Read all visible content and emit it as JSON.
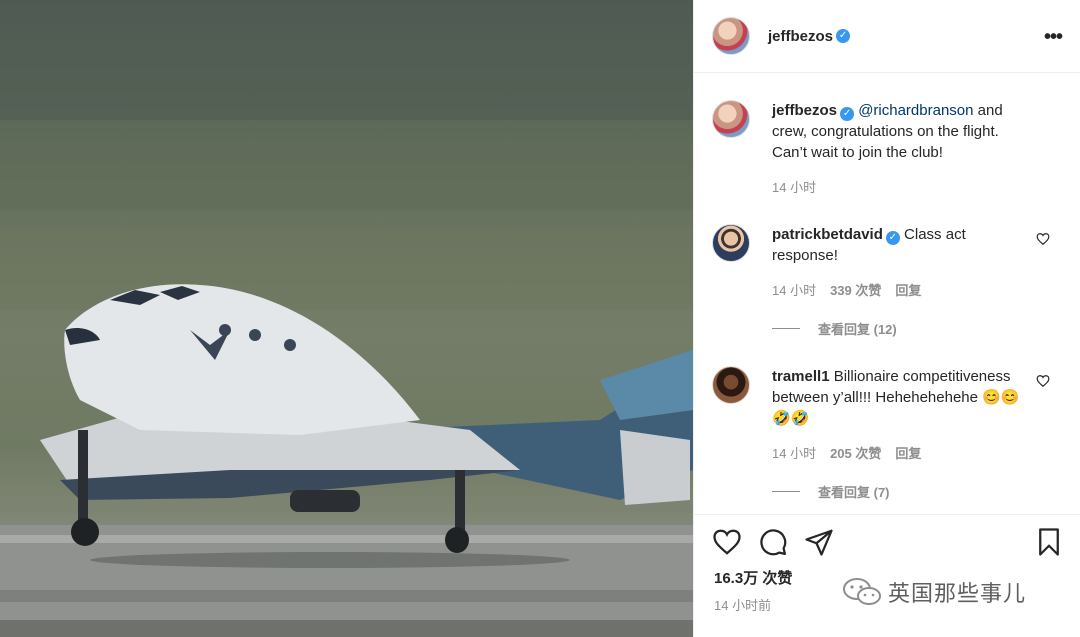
{
  "header": {
    "username": "jeffbezos",
    "more_label": "•••"
  },
  "caption": {
    "username": "jeffbezos",
    "mention": "@richardbranson",
    "text": " and crew, congratulations on the flight. Can’t wait to join the club!",
    "time": "14 小时"
  },
  "comments": [
    {
      "username": "patrickbetdavid",
      "verified": true,
      "text": "Class act response!",
      "time": "14 小时",
      "likes": "339 次赞",
      "reply": "回复",
      "view_replies": "查看回复 (12)"
    },
    {
      "username": "tramell1",
      "verified": false,
      "text": "Billionaire competitiveness between y’all!!! Hehehehehehe 😊😊🤣🤣",
      "time": "14 小时",
      "likes": "205 次赞",
      "reply": "回复",
      "view_replies": "查看回复 (7)"
    }
  ],
  "actions": {
    "like_count": "16.3万 次赞",
    "post_time": "14 小时前"
  },
  "watermark": {
    "text": "英国那些事儿"
  },
  "icons": [
    "more-icon",
    "verified-badge-icon",
    "heart-icon",
    "comment-icon",
    "share-icon",
    "bookmark-icon",
    "wechat-icon"
  ],
  "colors": {
    "verified": "#3897f0",
    "mention": "#00376b",
    "muted": "#8e8e8e",
    "text": "#262626"
  }
}
